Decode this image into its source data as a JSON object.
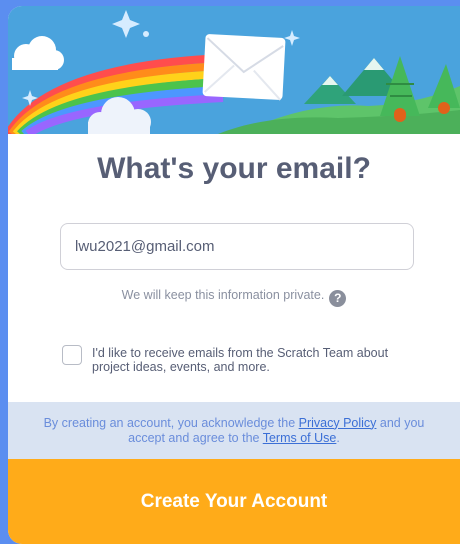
{
  "dialog": {
    "title": "What's your email?",
    "email_value": "lwu2021@gmail.com",
    "privacy_note": "We will keep this information private.",
    "help_glyph": "?",
    "optin_label": "I'd like to receive emails from the Scratch Team about project ideas, events, and more.",
    "optin_checked": false,
    "legal_prefix": "By creating an account, you acknowledge the ",
    "privacy_link": "Privacy Policy",
    "legal_middle": " and you accept and agree to the ",
    "terms_link": "Terms of Use",
    "legal_suffix": ".",
    "create_label": "Create Your Account"
  },
  "icons": {
    "banner": [
      "cloud-icon",
      "sparkle-icon",
      "rainbow-icon",
      "envelope-icon",
      "tree-icon",
      "mountain-icon"
    ],
    "help": "question-mark-icon"
  },
  "colors": {
    "page_background": "#5b8ef0",
    "title_text": "#575e75",
    "accent_button": "#ffab19",
    "legal_band": "#d9e3f2",
    "link": "#3b6fd6",
    "banner_sky": "#4aa3dd"
  }
}
